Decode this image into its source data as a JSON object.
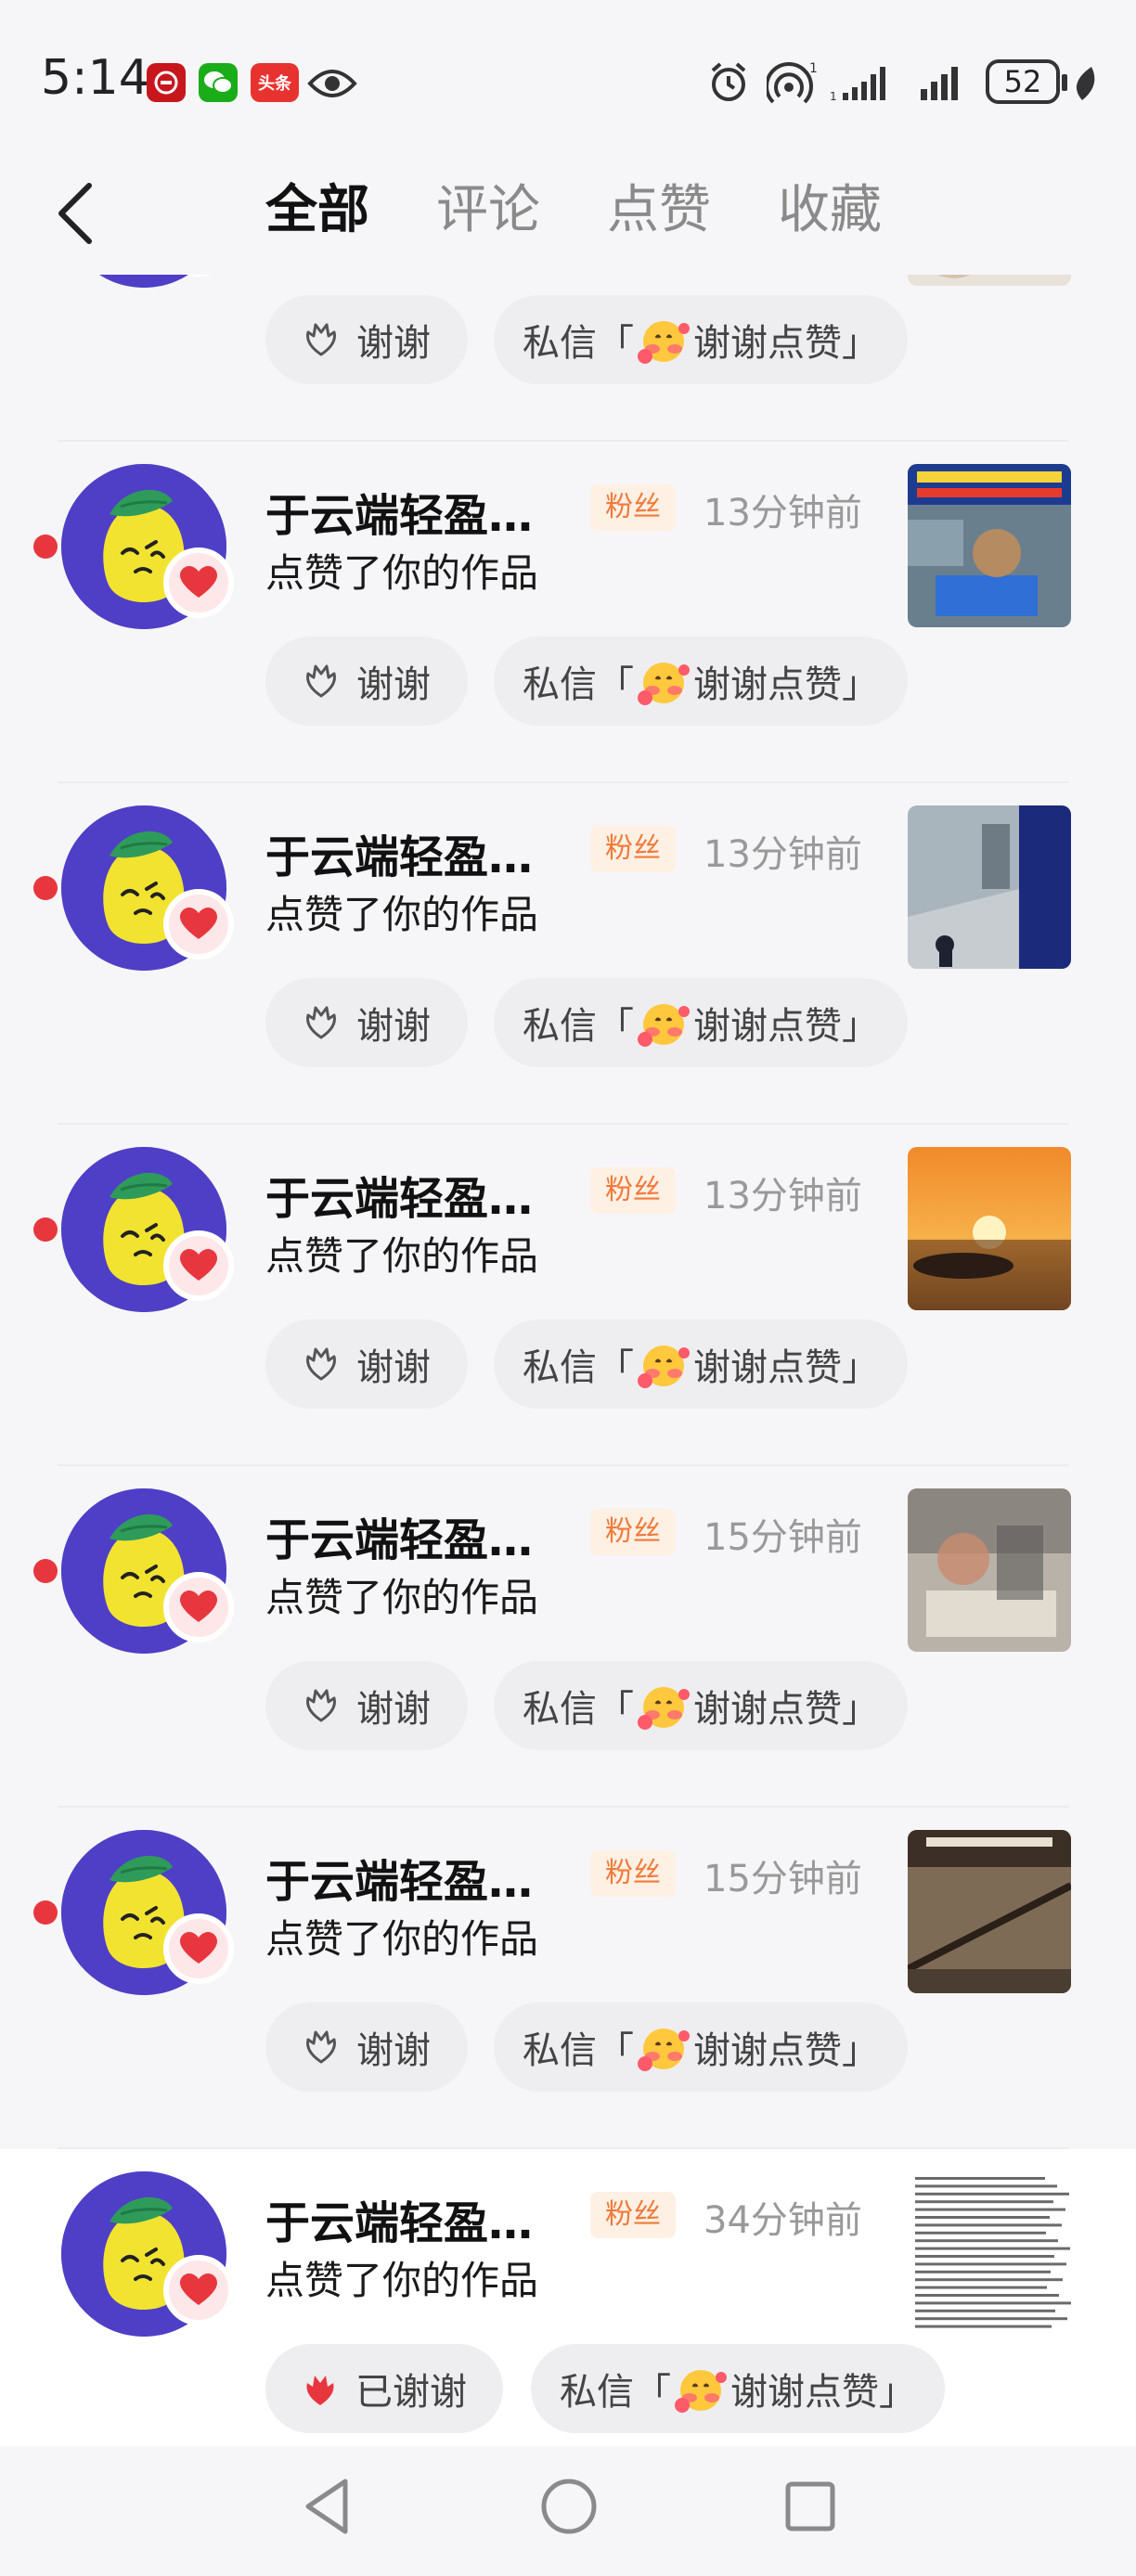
{
  "status_bar": {
    "time": "5:14",
    "app_icons": [
      "bank-icon",
      "wechat-icon",
      "toutiao-icon",
      "eye-icon"
    ],
    "toutiao_label": "头条",
    "battery": "52",
    "colors": {
      "bank": "#c8161d",
      "wechat": "#1aad19",
      "toutiao": "#e8322f"
    }
  },
  "header": {
    "tabs": [
      {
        "label": "全部",
        "active": true
      },
      {
        "label": "评论",
        "active": false
      },
      {
        "label": "点赞",
        "active": false
      },
      {
        "label": "收藏",
        "active": false
      }
    ]
  },
  "notifications": [
    {
      "name": "",
      "action": "点赞了你的作品",
      "thanks_label": "谢谢",
      "msg_prefix": "私信「",
      "msg_suffix": "谢谢点赞」",
      "unread": false
    },
    {
      "name": "于云端轻盈…",
      "badge": "粉丝",
      "time": "13分钟前",
      "action": "点赞了你的作品",
      "thanks_label": "谢谢",
      "msg_prefix": "私信「",
      "msg_suffix": "谢谢点赞」",
      "unread": true
    },
    {
      "name": "于云端轻盈…",
      "badge": "粉丝",
      "time": "13分钟前",
      "action": "点赞了你的作品",
      "thanks_label": "谢谢",
      "msg_prefix": "私信「",
      "msg_suffix": "谢谢点赞」",
      "unread": true
    },
    {
      "name": "于云端轻盈…",
      "badge": "粉丝",
      "time": "13分钟前",
      "action": "点赞了你的作品",
      "thanks_label": "谢谢",
      "msg_prefix": "私信「",
      "msg_suffix": "谢谢点赞」",
      "unread": true
    },
    {
      "name": "于云端轻盈…",
      "badge": "粉丝",
      "time": "15分钟前",
      "action": "点赞了你的作品",
      "thanks_label": "谢谢",
      "msg_prefix": "私信「",
      "msg_suffix": "谢谢点赞」",
      "unread": true
    },
    {
      "name": "于云端轻盈…",
      "badge": "粉丝",
      "time": "15分钟前",
      "action": "点赞了你的作品",
      "thanks_label": "谢谢",
      "msg_prefix": "私信「",
      "msg_suffix": "谢谢点赞」",
      "unread": true
    },
    {
      "name": "于云端轻盈…",
      "badge": "粉丝",
      "time": "34分钟前",
      "action": "点赞了你的作品",
      "thanks_label": "已谢谢",
      "msg_prefix": "私信「",
      "msg_suffix": "谢谢点赞」",
      "unread": false
    }
  ],
  "nav_bar": {
    "icons": [
      "back-triangle-icon",
      "home-circle-icon",
      "recents-square-icon"
    ]
  },
  "colors": {
    "unread_dot": "#e8363f",
    "avatar_bg": "#4e3fc6",
    "heart": "#e8363f",
    "fan_badge_text": "#f07a3a"
  }
}
